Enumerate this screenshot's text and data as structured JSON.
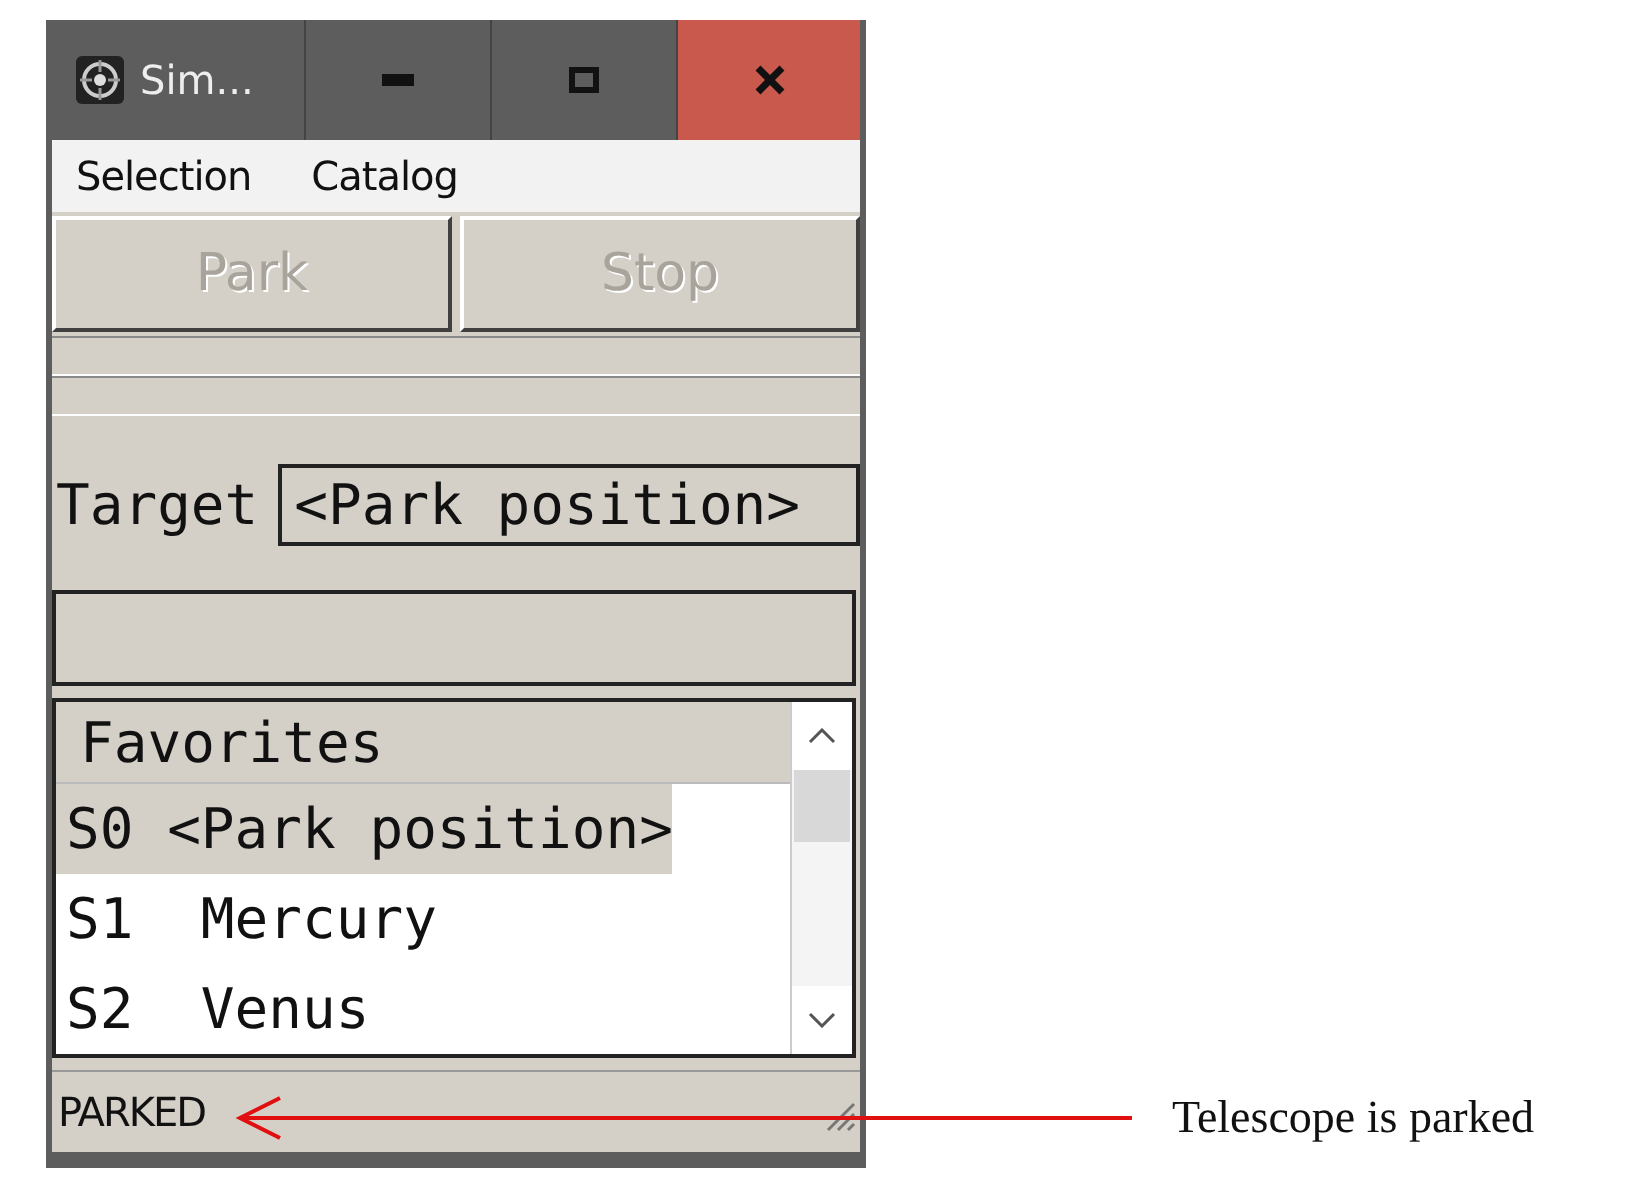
{
  "window": {
    "title": "Sim..."
  },
  "menu": [
    {
      "label": "Selection"
    },
    {
      "label": "Catalog"
    }
  ],
  "buttons": [
    {
      "label": "Park",
      "disabled": true
    },
    {
      "label": "Stop",
      "disabled": true
    }
  ],
  "target": {
    "label": "Target",
    "value": "<Park position>"
  },
  "favorites": {
    "header": "Favorites",
    "items": [
      {
        "code": "S0",
        "name": "<Park position>",
        "selected": true
      },
      {
        "code": "S1",
        "name": "Mercury",
        "selected": false
      },
      {
        "code": "S2",
        "name": "Venus",
        "selected": false
      }
    ]
  },
  "status_bar": "PARKED",
  "annotation": {
    "text": "Telescope is parked"
  }
}
